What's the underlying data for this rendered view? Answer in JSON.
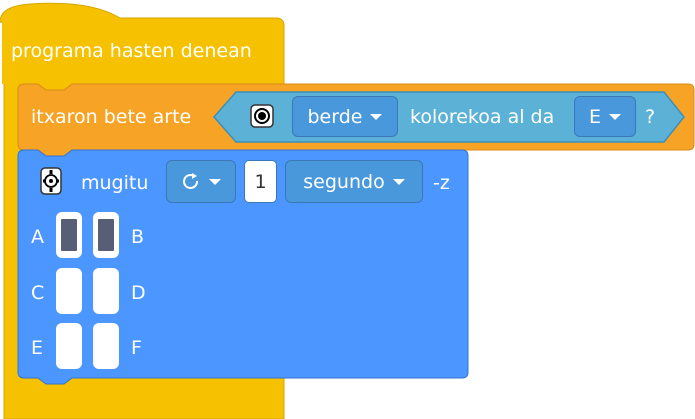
{
  "hat_block": {
    "label": "programa hasten denean"
  },
  "wait_block": {
    "label": "itxaron bete arte",
    "color_dropdown": "berde",
    "condition_text": "kolorekoa al da",
    "sensor_dropdown": "E",
    "question_mark": "?"
  },
  "move_block": {
    "label": "mugitu",
    "duration_value": "1",
    "unit_dropdown": "segundo",
    "suffix": "-z",
    "motors": [
      {
        "left": "A",
        "right": "B",
        "left_on": true,
        "right_on": true
      },
      {
        "left": "C",
        "right": "D",
        "left_on": false,
        "right_on": false
      },
      {
        "left": "E",
        "right": "F",
        "left_on": false,
        "right_on": false
      }
    ]
  },
  "colors": {
    "hat": "#f5c100",
    "wait": "#f7a325",
    "sensing": "#5cb1d6",
    "motion": "#4c97ff",
    "slot_fill": "#575e75"
  },
  "icons": [
    "color-sensor-icon",
    "robot-icon",
    "rotate-direction-icon",
    "dropdown-caret-icon"
  ]
}
